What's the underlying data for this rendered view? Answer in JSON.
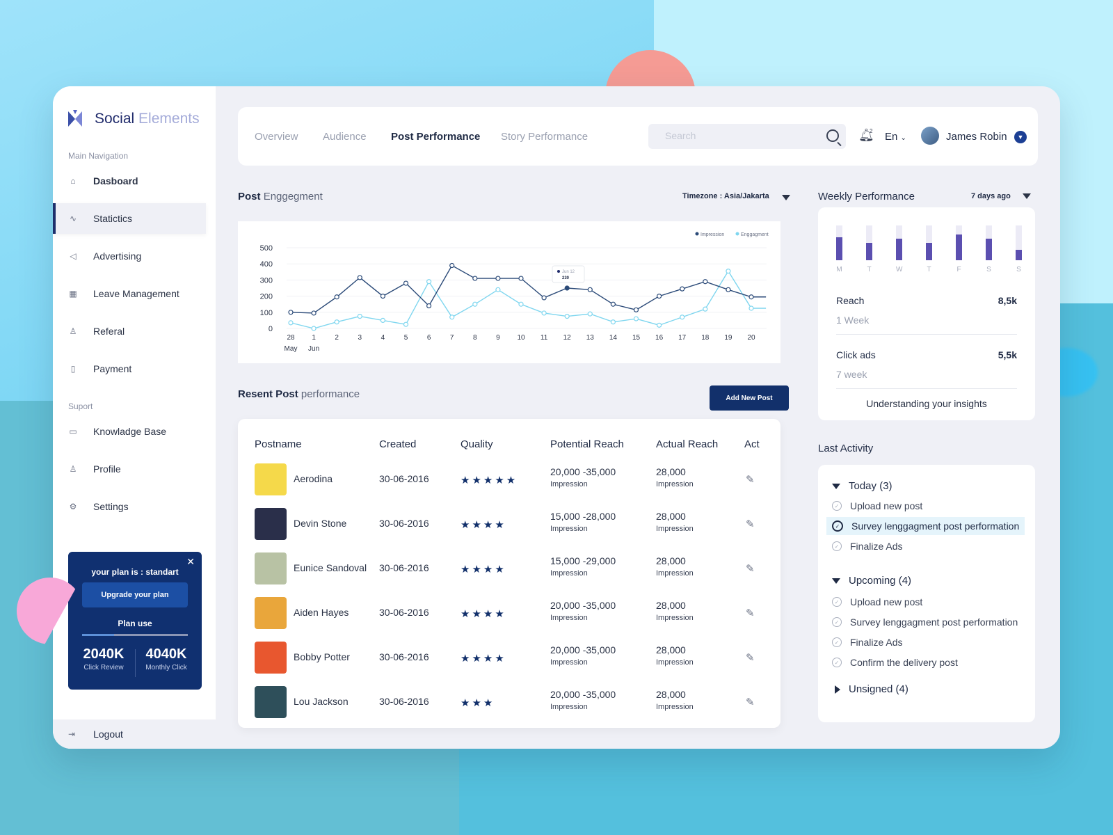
{
  "brand": {
    "name_bold": "Social",
    "name_light": "Elements"
  },
  "sidebar": {
    "main_heading": "Main Navigation",
    "main_items": [
      {
        "label": "Dasboard",
        "icon": "home-icon"
      },
      {
        "label": "Statictics",
        "icon": "trend-icon"
      },
      {
        "label": "Advertising",
        "icon": "megaphone-icon"
      },
      {
        "label": "Leave Management",
        "icon": "calendar-icon"
      },
      {
        "label": "Referal",
        "icon": "user-share-icon"
      },
      {
        "label": "Payment",
        "icon": "payment-icon"
      }
    ],
    "support_heading": "Suport",
    "support_items": [
      {
        "label": "Knowladge Base",
        "icon": "keyboard-icon"
      },
      {
        "label": "Profile",
        "icon": "user-icon"
      },
      {
        "label": "Settings",
        "icon": "gear-icon"
      }
    ],
    "logout": "Logout"
  },
  "plan": {
    "title": "your plan is : standart",
    "upgrade": "Upgrade your plan",
    "use_label": "Plan use",
    "use_fraction": 0.3,
    "stats": [
      {
        "value": "2040K",
        "label": "Click Review"
      },
      {
        "value": "4040K",
        "label": "Monthly Click"
      }
    ]
  },
  "topbar": {
    "tabs": [
      "Overview",
      "Audience",
      "Post Performance",
      "Story Performance"
    ],
    "active_tab": "Post Performance",
    "search_placeholder": "Search",
    "notification_count": "2",
    "lang": "En",
    "user": "James Robin"
  },
  "engagement": {
    "title_bold": "Post",
    "title_light": "Enggegment",
    "timezone": "Timezone : Asia/Jakarta"
  },
  "chart_data": {
    "type": "line",
    "x": [
      "28",
      "1",
      "2",
      "3",
      "4",
      "5",
      "6",
      "7",
      "8",
      "9",
      "10",
      "11",
      "12",
      "13",
      "14",
      "15",
      "16",
      "17",
      "18",
      "19",
      "20"
    ],
    "x_month_labels": [
      "May",
      "Jun"
    ],
    "ylim": [
      0,
      500
    ],
    "yticks": [
      "500",
      "400",
      "300",
      "200",
      "100",
      "0"
    ],
    "series": [
      {
        "name": "Impression",
        "color": "#2b4a78",
        "values": [
          100,
          95,
          195,
          315,
          200,
          280,
          140,
          390,
          310,
          310,
          310,
          190,
          250,
          240,
          150,
          115,
          200,
          245,
          290,
          240,
          195
        ]
      },
      {
        "name": "Enggagment",
        "color": "#7fd6ef",
        "values": [
          35,
          0,
          40,
          75,
          50,
          25,
          290,
          70,
          150,
          240,
          150,
          95,
          75,
          90,
          40,
          60,
          20,
          70,
          120,
          355,
          125
        ]
      }
    ],
    "tooltip": {
      "label": "Jun 12",
      "value": "230"
    },
    "legend": "top-right"
  },
  "recent": {
    "title_bold": "Resent Post",
    "title_light": "performance",
    "add_button": "Add New Post",
    "columns": [
      "Postname",
      "Created",
      "Quality",
      "Potential Reach",
      "Actual Reach",
      "Act"
    ],
    "rows": [
      {
        "name": "Aerodina",
        "created": "30-06-2016",
        "stars": 5,
        "potential": "20,000 -35,000",
        "potential_sub": "Impression",
        "actual": "28,000",
        "actual_sub": "Impression",
        "thumb_color": "#f5d94a"
      },
      {
        "name": "Devin Stone",
        "created": "30-06-2016",
        "stars": 4,
        "potential": "15,000 -28,000",
        "potential_sub": "Impression",
        "actual": "28,000",
        "actual_sub": "Impression",
        "thumb_color": "#2a2f4a"
      },
      {
        "name": "Eunice Sandoval",
        "created": "30-06-2016",
        "stars": 4,
        "potential": "15,000 -29,000",
        "potential_sub": "Impression",
        "actual": "28,000",
        "actual_sub": "Impression",
        "thumb_color": "#b8c2a4"
      },
      {
        "name": "Aiden Hayes",
        "created": "30-06-2016",
        "stars": 4,
        "potential": "20,000 -35,000",
        "potential_sub": "Impression",
        "actual": "28,000",
        "actual_sub": "Impression",
        "thumb_color": "#e9a63b"
      },
      {
        "name": "Bobby Potter",
        "created": "30-06-2016",
        "stars": 4,
        "potential": "20,000 -35,000",
        "potential_sub": "Impression",
        "actual": "28,000",
        "actual_sub": "Impression",
        "thumb_color": "#e8572f"
      },
      {
        "name": "Lou Jackson",
        "created": "30-06-2016",
        "stars": 3,
        "potential": "20,000 -35,000",
        "potential_sub": "Impression",
        "actual": "28,000",
        "actual_sub": "Impression",
        "thumb_color": "#2e4f5a"
      }
    ]
  },
  "weekly": {
    "title": "Weekly Performance",
    "range": "7 days ago",
    "days": [
      "M",
      "T",
      "W",
      "T",
      "F",
      "S",
      "S"
    ],
    "levels": [
      0.66,
      0.5,
      0.62,
      0.5,
      0.74,
      0.62,
      0.3
    ],
    "reach_label": "Reach",
    "reach_value": "8,5k",
    "reach_sub": "1 Week",
    "click_label": "Click ads",
    "click_value": "5,5k",
    "click_sub": "7 week",
    "link": "Understanding your insights"
  },
  "activity": {
    "title": "Last Activity",
    "today": "Today (3)",
    "today_items": [
      "Upload new post",
      "Survey lenggagment post performation",
      "Finalize Ads"
    ],
    "upcoming": "Upcoming (4)",
    "upcoming_items": [
      "Upload new post",
      "Survey lenggagment post performation",
      "Finalize Ads",
      "Confirm the delivery post"
    ],
    "unsigned": "Unsigned (4)"
  }
}
